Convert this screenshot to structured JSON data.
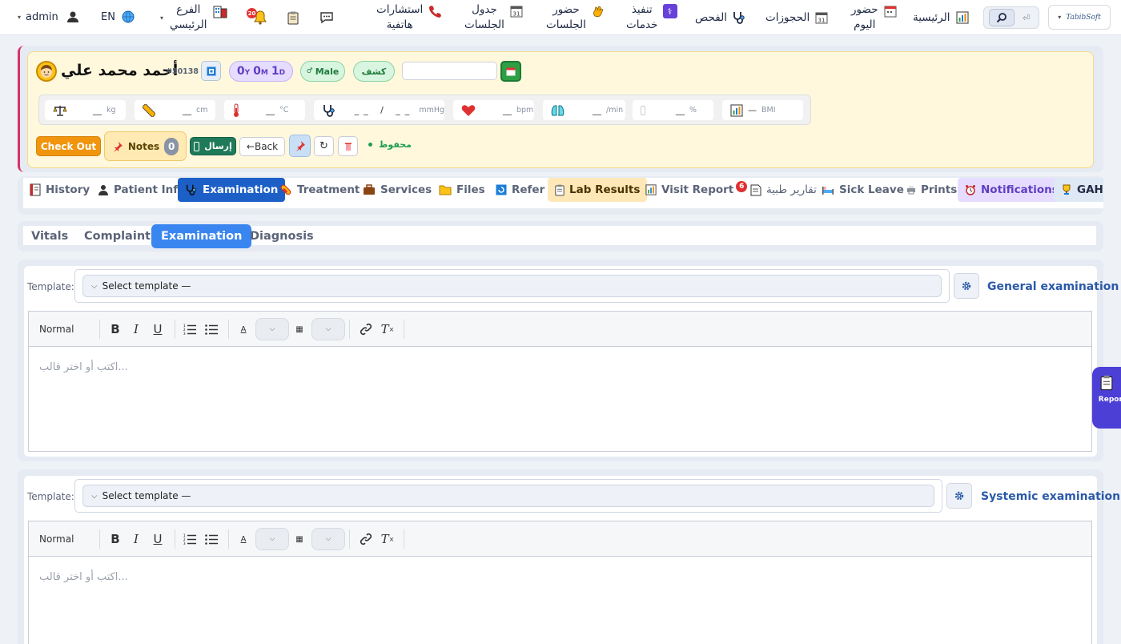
{
  "topbar": {
    "logo": "TabibSoft",
    "nav": [
      {
        "label": "الرئيسية",
        "icon": "bar-chart-icon"
      },
      {
        "label": "حضور\nاليوم",
        "icon": "calendar-icon"
      },
      {
        "label": "الحجوزات",
        "icon": "calendar-31-icon"
      },
      {
        "label": "الفحص",
        "icon": "stethoscope-icon"
      },
      {
        "label": "تنفيذ\nخدمات",
        "icon": "medical-icon"
      },
      {
        "label": "حضور\nالجلسات",
        "icon": "hand-icon"
      },
      {
        "label": "جدول\nالجلسات",
        "icon": "calendar-31-icon"
      },
      {
        "label": "استشارات\nهاتفية",
        "icon": "phone-icon"
      }
    ],
    "notification_count": "20",
    "branch_label": "الفرع\nالرئيسي",
    "language": "EN",
    "user": "admin"
  },
  "patient": {
    "name": "أحمد محمد علي",
    "id": "#50138",
    "age_y": "0",
    "age_y_unit": "Y",
    "age_m": "0",
    "age_m_unit": "M",
    "age_d": "1",
    "age_d_unit": "D",
    "gender": "Male",
    "visit_type": "كشف",
    "date_value": ""
  },
  "vitals": [
    {
      "name": "weight",
      "blank": "__",
      "unit": "kg",
      "icon": "scale-icon"
    },
    {
      "name": "height",
      "blank": "__",
      "unit": "cm",
      "icon": "ruler-icon"
    },
    {
      "name": "temperature",
      "blank": "__",
      "unit": "°C",
      "icon": "thermometer-icon"
    },
    {
      "name": "blood-pressure",
      "blank": "__ / __",
      "unit": "mmHg",
      "icon": "stethoscope-icon"
    },
    {
      "name": "pulse",
      "blank": "__",
      "unit": "bpm",
      "icon": "heart-icon"
    },
    {
      "name": "respiration",
      "blank": "__",
      "unit": "/min",
      "icon": "lungs-icon"
    },
    {
      "name": "spo2",
      "blank": "__",
      "unit": "%",
      "icon": "drop-icon"
    },
    {
      "name": "bmi",
      "blank": "—",
      "unit": "BMI",
      "icon": "bar-chart-icon"
    }
  ],
  "actions": {
    "checkout": "Check Out",
    "notes": "Notes",
    "notes_count": "0",
    "send": "إرسال",
    "back": "←Back",
    "saved": "محفوظ"
  },
  "tabs": [
    {
      "label": "History",
      "icon": "history-icon"
    },
    {
      "label": "Patient Info",
      "icon": "person-icon"
    },
    {
      "label": "Examination",
      "icon": "stethoscope-icon",
      "active": true
    },
    {
      "label": "Treatment",
      "icon": "pill-icon"
    },
    {
      "label": "Services",
      "icon": "briefcase-icon"
    },
    {
      "label": "Files",
      "icon": "folder-icon"
    },
    {
      "label": "Refer",
      "icon": "refer-icon"
    },
    {
      "label": "Lab Results",
      "icon": "clipboard-icon"
    },
    {
      "label": "Visit Report",
      "icon": "bar-chart-icon",
      "badge": "6"
    },
    {
      "label": "تقارير طبية",
      "icon": "document-icon"
    },
    {
      "label": "Sick Leave",
      "icon": "bed-icon"
    },
    {
      "label": "Prints",
      "icon": "printer-icon"
    },
    {
      "label": "Notifications",
      "icon": "alarm-icon"
    },
    {
      "label": "GAHA",
      "icon": "trophy-icon"
    }
  ],
  "subtabs": [
    "Vitals",
    "Complaint",
    "Examination",
    "Diagnosis"
  ],
  "active_subtab": "Examination",
  "sections": [
    {
      "title": "General examination",
      "template_label": "Template:",
      "template_value": "Select template —",
      "format": "Normal",
      "placeholder": "...اكتب أو اختر قالب"
    },
    {
      "title": "Systemic examination",
      "template_label": "Template:",
      "template_value": "Select template —",
      "format": "Normal",
      "placeholder": "...اكتب أو اختر قالب"
    }
  ],
  "side_report": "Report",
  "colors": {
    "accent": "#2f6fd6",
    "checkout": "#f0950d",
    "saved": "#1f9d55",
    "card_bg": "#fff8dc",
    "badge": "#e03131"
  }
}
